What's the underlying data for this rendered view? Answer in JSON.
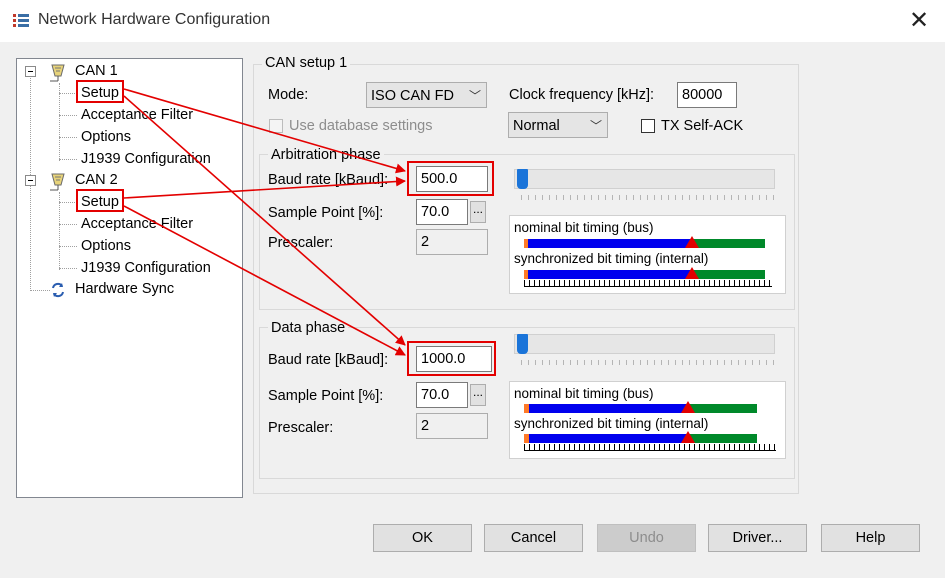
{
  "window": {
    "title": "Network Hardware Configuration"
  },
  "tree": {
    "can1": "CAN 1",
    "can1_items": [
      "Setup",
      "Acceptance Filter",
      "Options",
      "J1939 Configuration"
    ],
    "can2": "CAN 2",
    "can2_items": [
      "Setup",
      "Acceptance Filter",
      "Options",
      "J1939 Configuration"
    ],
    "hwsync": "Hardware Sync"
  },
  "setup": {
    "group_title": "CAN setup 1",
    "mode_label": "Mode:",
    "mode_value": "ISO CAN FD",
    "clock_label": "Clock frequency [kHz]:",
    "clock_value": "80000",
    "use_db_label": "Use database settings",
    "normal_value": "Normal",
    "txselfack_label": "TX Self-ACK"
  },
  "arbitration": {
    "title": "Arbitration phase",
    "baud_label": "Baud rate [kBaud]:",
    "baud_value": "500.0",
    "sample_label": "Sample Point [%]:",
    "sample_value": "70.0",
    "prescaler_label": "Prescaler:",
    "prescaler_value": "2",
    "nominal_label": "nominal bit timing (bus)",
    "sync_label": "synchronized bit timing (internal)"
  },
  "data_phase": {
    "title": "Data phase",
    "baud_label": "Baud rate [kBaud]:",
    "baud_value": "1000.0",
    "sample_label": "Sample Point [%]:",
    "sample_value": "70.0",
    "prescaler_label": "Prescaler:",
    "prescaler_value": "2",
    "nominal_label": "nominal bit timing (bus)",
    "sync_label": "synchronized bit timing (internal)"
  },
  "browse_label": "...",
  "buttons": {
    "ok": "OK",
    "cancel": "Cancel",
    "undo": "Undo",
    "driver": "Driver...",
    "help": "Help"
  },
  "colors": {
    "highlight": "#e30000",
    "bar_blue": "#0000ee",
    "bar_green": "#00892a",
    "bar_orange": "#ff7a28",
    "marker": "#e00000"
  }
}
